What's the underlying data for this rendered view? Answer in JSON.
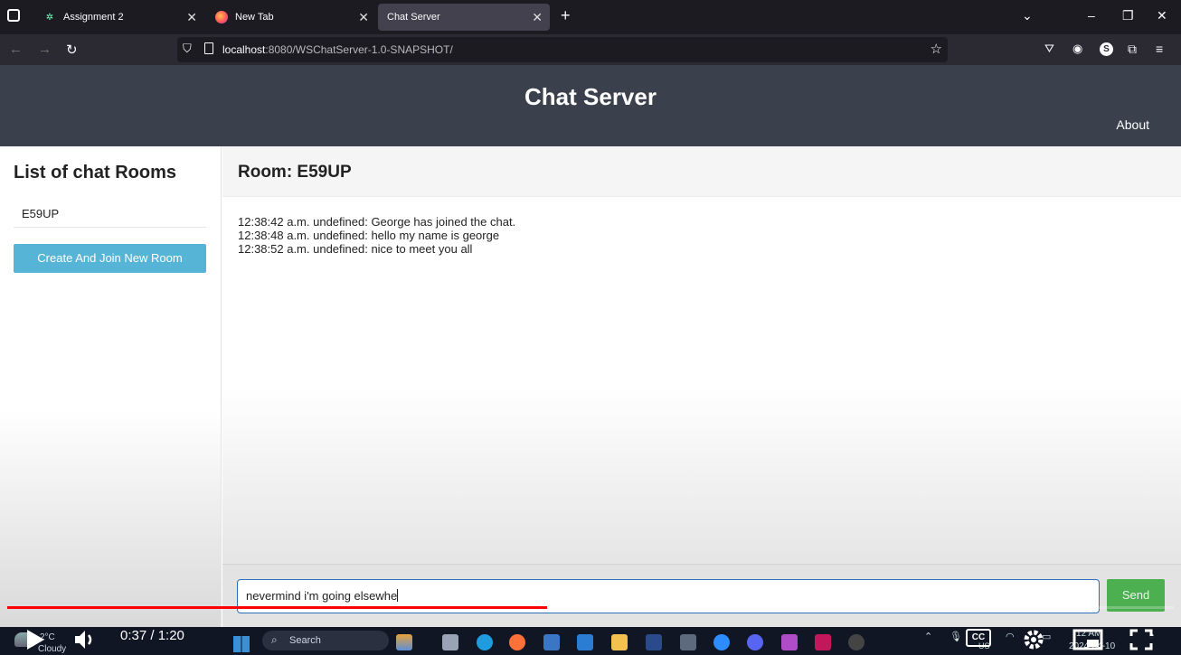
{
  "browser": {
    "tabs": [
      {
        "label": "Assignment 2",
        "favicon": "netlify-icon"
      },
      {
        "label": "New Tab",
        "favicon": "firefox-icon"
      },
      {
        "label": "Chat Server",
        "favicon": "none",
        "active": true
      }
    ],
    "url_host": "localhost",
    "url_path": ":8080/WSChatServer-1.0-SNAPSHOT/",
    "profile_initial": "S"
  },
  "app": {
    "title": "Chat Server",
    "about_link": "About",
    "sidebar": {
      "heading": "List of chat Rooms",
      "rooms": [
        "E59UP"
      ],
      "create_button": "Create And Join New Room"
    },
    "room": {
      "title": "Room: E59UP",
      "messages": [
        "12:38:42 a.m. undefined: George has joined the chat.",
        "12:38:48 a.m. undefined: hello my name is george",
        "12:38:52 a.m. undefined: nice to meet you all"
      ],
      "input_value": "nevermind i'm going elsewhe",
      "send_button": "Send"
    },
    "colors": {
      "header_bg": "#3a414d",
      "create_button_bg": "#56b4d6",
      "send_button_bg": "#4caf50",
      "input_border": "#2a70b8"
    }
  },
  "player": {
    "time_display": "0:37 / 1:20",
    "progress_fraction": 0.4625,
    "buffered_fraction": 0.75,
    "cc_label": "CC",
    "progress_color": "#ff0000"
  },
  "taskbar": {
    "weather_temp": "2°C",
    "weather_desc": "Cloudy",
    "search_placeholder": "Search",
    "tray_lang": "US",
    "clock_time": "12 AM",
    "clock_date": "2024-04-10"
  }
}
